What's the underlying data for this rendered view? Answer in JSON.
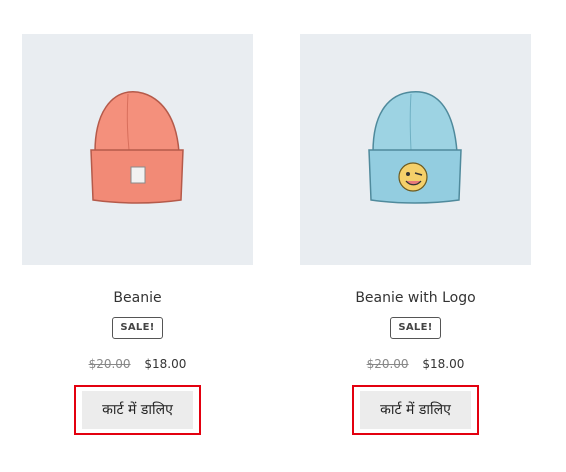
{
  "products": [
    {
      "title": "Beanie",
      "badge": "SALE!",
      "old_price": "$20.00",
      "new_price": "$18.00",
      "button_label": "कार्ट में डालिए",
      "image_color": "#f4907c",
      "image_icon": "beanie-image"
    },
    {
      "title": "Beanie with Logo",
      "badge": "SALE!",
      "old_price": "$20.00",
      "new_price": "$18.00",
      "button_label": "कार्ट में डालिए",
      "image_color": "#9dd3e3",
      "image_icon": "beanie-with-logo-image"
    }
  ],
  "colors": {
    "thumb_bg": "#e9edf1",
    "button_bg": "#ececec",
    "highlight_outline": "#e3000f"
  }
}
